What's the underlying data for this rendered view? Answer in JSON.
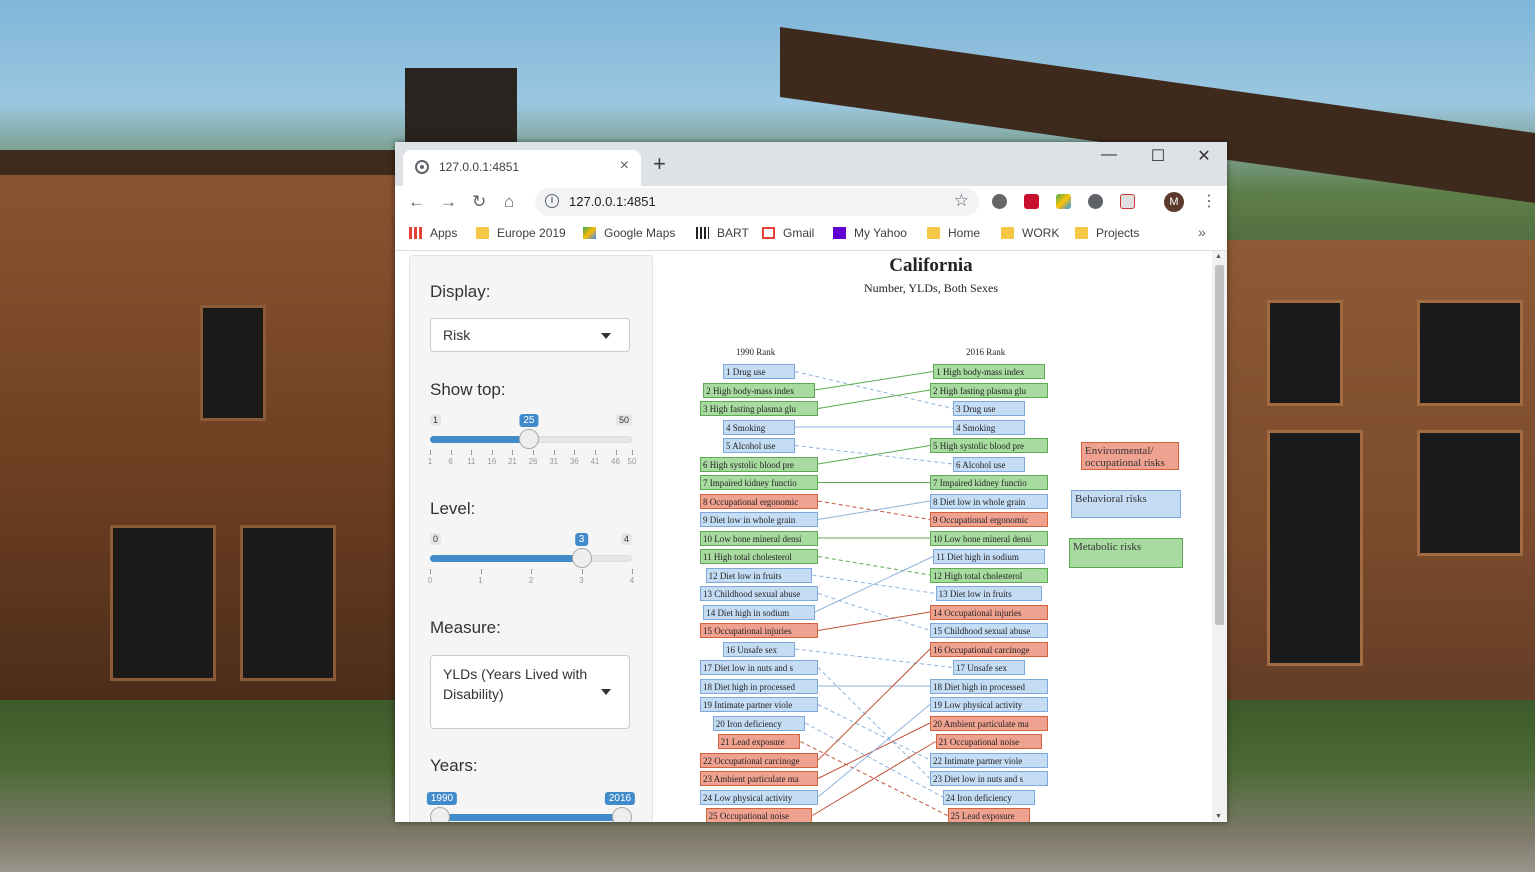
{
  "browser": {
    "tab_title": "127.0.0.1:4851",
    "tab_close": "×",
    "new_tab": "+",
    "win_min": "—",
    "win_max": "☐",
    "win_close": "✕",
    "url": "127.0.0.1:4851",
    "avatar_initial": "M",
    "bookmarks": [
      {
        "label": "Apps",
        "icon": "apps-grid-icon"
      },
      {
        "label": "Europe 2019",
        "icon": "folder-icon"
      },
      {
        "label": "Google Maps",
        "icon": "google-maps-icon"
      },
      {
        "label": "BART",
        "icon": "bart-icon"
      },
      {
        "label": "Gmail",
        "icon": "gmail-icon"
      },
      {
        "label": "My Yahoo",
        "icon": "yahoo-icon"
      },
      {
        "label": "Home",
        "icon": "folder-icon"
      },
      {
        "label": "WORK",
        "icon": "folder-icon"
      },
      {
        "label": "Projects",
        "icon": "folder-icon"
      }
    ],
    "bookmarks_more": "»"
  },
  "sidebar": {
    "display_label": "Display:",
    "display_value": "Risk",
    "showtop_label": "Show top:",
    "showtop": {
      "min": 1,
      "max": 50,
      "value": 25,
      "ticks": [
        1,
        6,
        11,
        16,
        21,
        26,
        31,
        36,
        41,
        46,
        50
      ]
    },
    "level_label": "Level:",
    "level": {
      "min": 0,
      "max": 4,
      "value": 3,
      "ticks": [
        0,
        1,
        2,
        3,
        4
      ]
    },
    "measure_label": "Measure:",
    "measure_value": "YLDs (Years Lived with Disability)",
    "years_label": "Years:",
    "years": {
      "min": 1990,
      "max": 2016,
      "from": 1990,
      "to": 2016
    }
  },
  "chart_data": {
    "type": "table",
    "title": "California",
    "subtitle": "Number, YLDs, Both Sexes",
    "left_header": "1990 Rank",
    "right_header": "2016 Rank",
    "colors": {
      "env": "#f0a291",
      "env_border": "#d3623f",
      "beh": "#c5dcf5",
      "beh_border": "#7ea8d8",
      "met": "#a8dba0",
      "met_border": "#5daa52"
    },
    "legend": [
      {
        "label": "Environmental/ occupational risks",
        "cat": "env"
      },
      {
        "label": "Behavioral risks",
        "cat": "beh"
      },
      {
        "label": "Metabolic risks",
        "cat": "met"
      }
    ],
    "left": [
      {
        "label": "1 Drug use",
        "cat": "beh"
      },
      {
        "label": "2 High body-mass index",
        "cat": "met"
      },
      {
        "label": "3 High fasting plasma glu",
        "cat": "met"
      },
      {
        "label": "4 Smoking",
        "cat": "beh"
      },
      {
        "label": "5 Alcohol use",
        "cat": "beh"
      },
      {
        "label": "6 High systolic blood pre",
        "cat": "met"
      },
      {
        "label": "7 Impaired kidney functio",
        "cat": "met"
      },
      {
        "label": "8 Occupational ergonomic",
        "cat": "env"
      },
      {
        "label": "9 Diet low in whole grain",
        "cat": "beh"
      },
      {
        "label": "10 Low bone mineral densi",
        "cat": "met"
      },
      {
        "label": "11 High total cholesterol",
        "cat": "met"
      },
      {
        "label": "12 Diet low in fruits",
        "cat": "beh"
      },
      {
        "label": "13 Childhood sexual abuse",
        "cat": "beh"
      },
      {
        "label": "14 Diet high in sodium",
        "cat": "beh"
      },
      {
        "label": "15 Occupational injuries",
        "cat": "env"
      },
      {
        "label": "16 Unsafe sex",
        "cat": "beh"
      },
      {
        "label": "17 Diet low in nuts and s",
        "cat": "beh"
      },
      {
        "label": "18 Diet high in processed",
        "cat": "beh"
      },
      {
        "label": "19 Intimate partner viole",
        "cat": "beh"
      },
      {
        "label": "20 Iron deficiency",
        "cat": "beh"
      },
      {
        "label": "21 Lead exposure",
        "cat": "env"
      },
      {
        "label": "22 Occupational carcinoge",
        "cat": "env"
      },
      {
        "label": "23 Ambient particulate ma",
        "cat": "env"
      },
      {
        "label": "24 Low physical activity",
        "cat": "beh"
      },
      {
        "label": "25 Occupational noise",
        "cat": "env"
      }
    ],
    "right": [
      {
        "label": "1 High body-mass index",
        "cat": "met"
      },
      {
        "label": "2 High fasting plasma glu",
        "cat": "met"
      },
      {
        "label": "3 Drug use",
        "cat": "beh"
      },
      {
        "label": "4 Smoking",
        "cat": "beh"
      },
      {
        "label": "5 High systolic blood pre",
        "cat": "met"
      },
      {
        "label": "6 Alcohol use",
        "cat": "beh"
      },
      {
        "label": "7 Impaired kidney functio",
        "cat": "met"
      },
      {
        "label": "8 Diet low in whole grain",
        "cat": "beh"
      },
      {
        "label": "9 Occupational ergonomic",
        "cat": "env"
      },
      {
        "label": "10 Low bone mineral densi",
        "cat": "met"
      },
      {
        "label": "11 Diet high in sodium",
        "cat": "beh"
      },
      {
        "label": "12 High total cholesterol",
        "cat": "met"
      },
      {
        "label": "13 Diet low in fruits",
        "cat": "beh"
      },
      {
        "label": "14 Occupational injuries",
        "cat": "env"
      },
      {
        "label": "15 Childhood sexual abuse",
        "cat": "beh"
      },
      {
        "label": "16 Occupational carcinoge",
        "cat": "env"
      },
      {
        "label": "17 Unsafe sex",
        "cat": "beh"
      },
      {
        "label": "18 Diet high in processed",
        "cat": "beh"
      },
      {
        "label": "19 Low physical activity",
        "cat": "beh"
      },
      {
        "label": "20 Ambient particulate ma",
        "cat": "env"
      },
      {
        "label": "21 Occupational noise",
        "cat": "env"
      },
      {
        "label": "22 Intimate partner viole",
        "cat": "beh"
      },
      {
        "label": "23 Diet low in nuts and s",
        "cat": "beh"
      },
      {
        "label": "24 Iron deficiency",
        "cat": "beh"
      },
      {
        "label": "25 Lead exposure",
        "cat": "env"
      }
    ],
    "links": [
      [
        1,
        3
      ],
      [
        2,
        1
      ],
      [
        3,
        2
      ],
      [
        4,
        4
      ],
      [
        5,
        6
      ],
      [
        6,
        5
      ],
      [
        7,
        7
      ],
      [
        8,
        9
      ],
      [
        9,
        8
      ],
      [
        10,
        10
      ],
      [
        11,
        12
      ],
      [
        12,
        13
      ],
      [
        13,
        15
      ],
      [
        14,
        11
      ],
      [
        15,
        14
      ],
      [
        16,
        17
      ],
      [
        17,
        23
      ],
      [
        18,
        18
      ],
      [
        19,
        22
      ],
      [
        20,
        24
      ],
      [
        21,
        25
      ],
      [
        22,
        16
      ],
      [
        23,
        20
      ],
      [
        24,
        19
      ],
      [
        25,
        21
      ]
    ]
  }
}
